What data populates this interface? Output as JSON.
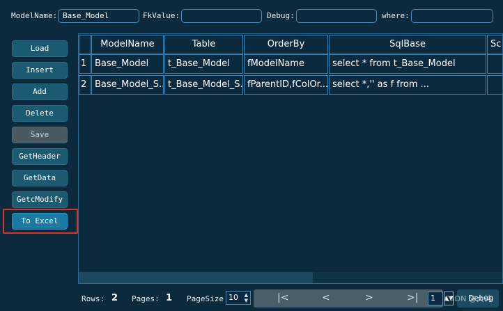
{
  "filters": {
    "model_name_label": "ModelName:",
    "model_name_value": "Base_Model",
    "fk_value_label": "FkValue:",
    "fk_value_value": "",
    "debug_label": "Debug:",
    "debug_value": "",
    "where_label": "where:",
    "where_value": ""
  },
  "sidebar": {
    "load": "Load",
    "insert": "Insert",
    "add": "Add",
    "delete": "Delete",
    "save": "Save",
    "get_header": "GetHeader",
    "get_data": "GetData",
    "get_modify": "GetcModify",
    "to_excel": "To Excel"
  },
  "grid": {
    "columns": [
      "ModelName",
      "Table",
      "OrderBy",
      "SqlBase",
      "Sc"
    ],
    "rows": [
      {
        "num": "1",
        "cells": [
          "Base_Model",
          "t_Base_Model",
          "fModelName",
          "select * from t_Base_Model",
          ""
        ]
      },
      {
        "num": "2",
        "cells": [
          "Base_Model_S...",
          "t_Base_Model_S...",
          "fParentID,fColOr...",
          "select *,'' as f from ...",
          ""
        ]
      }
    ]
  },
  "footer": {
    "rows_label": "Rows:",
    "rows_value": "2",
    "pages_label": "Pages:",
    "pages_value": "1",
    "pagesize_label": "PageSize",
    "pagesize_value": "10",
    "current_page": "1",
    "debug_button": "Debug"
  },
  "icons": {
    "first": "first-page-icon",
    "prev": "prev-page-icon",
    "next": "next-page-icon",
    "last": "last-page-icon"
  },
  "watermark": "CSDN @大神"
}
